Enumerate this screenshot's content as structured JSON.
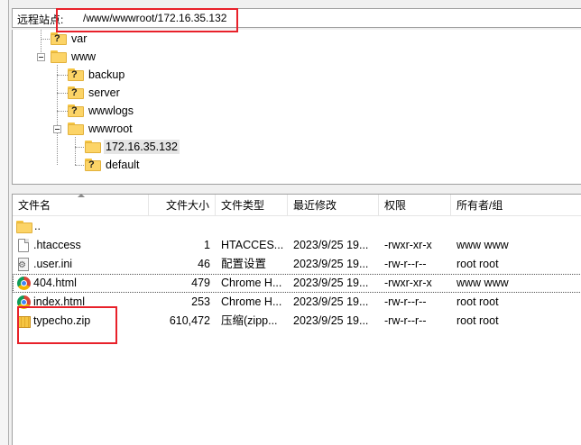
{
  "site_bar": {
    "label": "远程站点:",
    "path": "/www/wwwroot/172.16.35.132"
  },
  "tree": [
    {
      "label": "var",
      "icon": "folder-unknown-icon",
      "state": "leaf"
    },
    {
      "label": "www",
      "icon": "folder-open-icon",
      "state": "expanded"
    },
    {
      "label": "backup",
      "icon": "folder-unknown-icon",
      "state": "leaf"
    },
    {
      "label": "server",
      "icon": "folder-unknown-icon",
      "state": "leaf"
    },
    {
      "label": "wwwlogs",
      "icon": "folder-unknown-icon",
      "state": "leaf"
    },
    {
      "label": "wwwroot",
      "icon": "folder-open-icon",
      "state": "expanded"
    },
    {
      "label": "172.16.35.132",
      "icon": "folder-icon",
      "state": "selected"
    },
    {
      "label": "default",
      "icon": "folder-unknown-icon",
      "state": "leaf"
    }
  ],
  "columns": {
    "name": "文件名",
    "size": "文件大小",
    "type": "文件类型",
    "modified": "最近修改",
    "perms": "权限",
    "owner": "所有者/组"
  },
  "files": [
    {
      "name": "..",
      "size": "",
      "type": "",
      "modified": "",
      "perms": "",
      "owner": "",
      "icon": "parent-folder-icon"
    },
    {
      "name": ".htaccess",
      "size": "1",
      "type": "HTACCES...",
      "modified": "2023/9/25 19...",
      "perms": "-rwxr-xr-x",
      "owner": "www www",
      "icon": "file-icon"
    },
    {
      "name": ".user.ini",
      "size": "46",
      "type": "配置设置",
      "modified": "2023/9/25 19...",
      "perms": "-rw-r--r--",
      "owner": "root root",
      "icon": "config-file-icon"
    },
    {
      "name": "404.html",
      "size": "479",
      "type": "Chrome H...",
      "modified": "2023/9/25 19...",
      "perms": "-rwxr-xr-x",
      "owner": "www www",
      "icon": "chrome-icon"
    },
    {
      "name": "index.html",
      "size": "253",
      "type": "Chrome H...",
      "modified": "2023/9/25 19...",
      "perms": "-rw-r--r--",
      "owner": "root root",
      "icon": "chrome-icon"
    },
    {
      "name": "typecho.zip",
      "size": "610,472",
      "type": "压缩(zipp...",
      "modified": "2023/9/25 19...",
      "perms": "-rw-r--r--",
      "owner": "root root",
      "icon": "zip-icon"
    }
  ],
  "colors": {
    "annotation_red": "#e8212a",
    "selection_gray": "#e5e5e5"
  }
}
